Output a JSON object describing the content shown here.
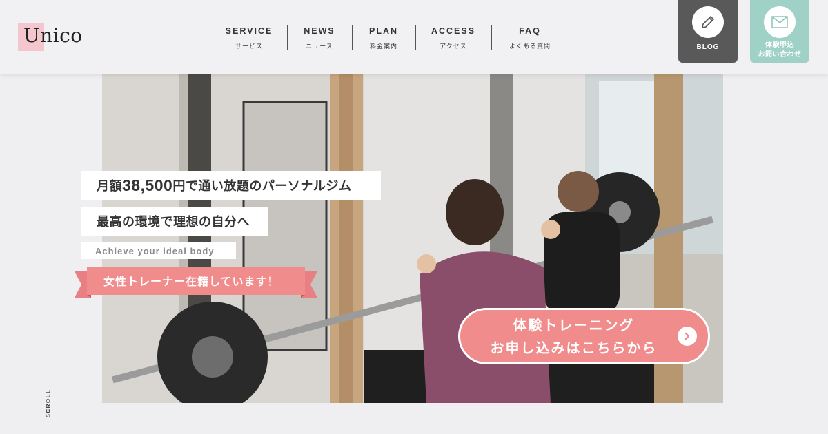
{
  "brand": {
    "logo_text": "Unico",
    "accent": "#f4c7cf"
  },
  "nav": [
    {
      "en": "SERVICE",
      "jp": "サービス"
    },
    {
      "en": "NEWS",
      "jp": "ニュース"
    },
    {
      "en": "PLAN",
      "jp": "料金案内"
    },
    {
      "en": "ACCESS",
      "jp": "アクセス"
    },
    {
      "en": "FAQ",
      "jp": "よくある質問"
    }
  ],
  "header_buttons": {
    "blog": {
      "label": "BLOG",
      "icon": "pencil-icon",
      "color": "#595959"
    },
    "trial": {
      "label_line1": "体験申込",
      "label_line2": "お問い合わせ",
      "icon": "mail-icon",
      "color": "#9fd1c6"
    }
  },
  "hero": {
    "tag1_prefix": "月額",
    "tag1_price": "38,500",
    "tag1_suffix": "円で通い放題のパーソナルジム",
    "tag2": "最高の環境で理想の自分へ",
    "tag3": "Achieve your ideal body",
    "ribbon": "女性トレーナー在籍しています！",
    "ribbon_color": "#f08c8c",
    "cta_line1": "体験トレーニング",
    "cta_line2": "お申し込みはこちらから",
    "cta_color": "#f08c8c",
    "cta_icon": "chevron-right-icon"
  },
  "scroll_label": "SCROLL"
}
